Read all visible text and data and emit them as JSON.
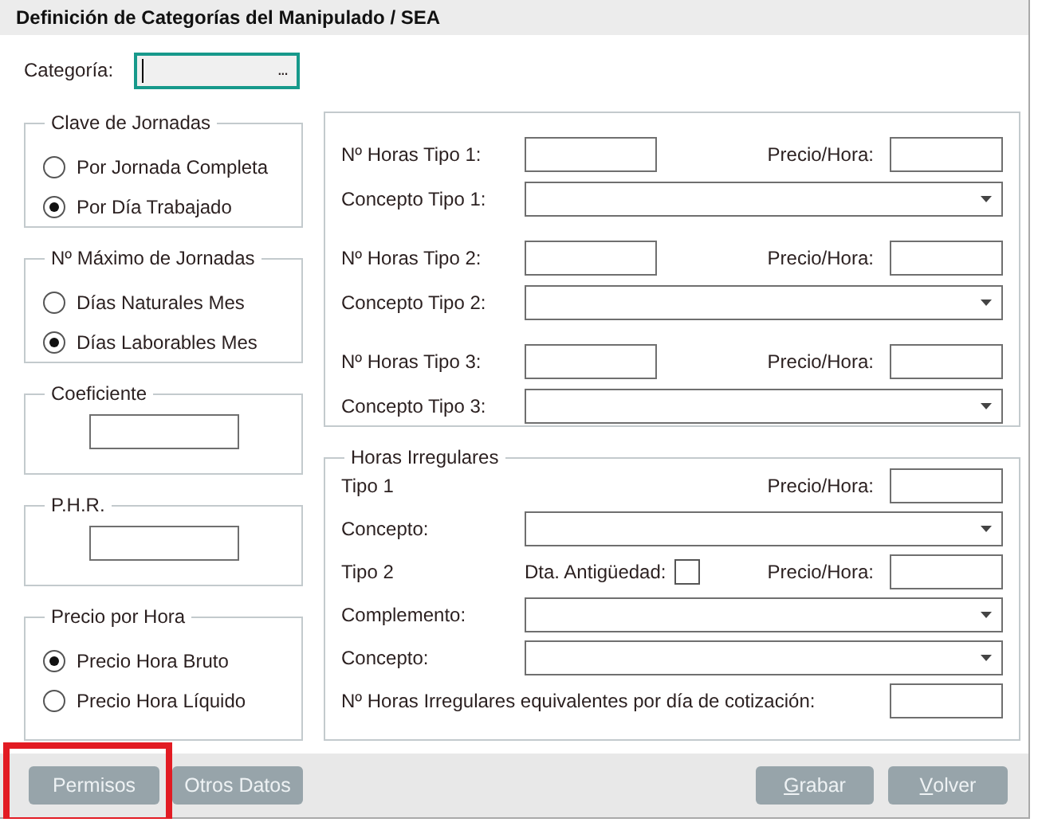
{
  "window": {
    "title": "Definición de Categorías del Manipulado / SEA"
  },
  "categoria": {
    "label": "Categoría:",
    "lookup_button": "...",
    "focused": true
  },
  "left_groups": [
    {
      "kind": "radio",
      "legend": "Clave de Jornadas",
      "options": [
        {
          "label": "Por Jornada Completa",
          "selected": false
        },
        {
          "label": "Por Día Trabajado",
          "selected": true
        }
      ]
    },
    {
      "kind": "radio",
      "legend": "Nº Máximo de Jornadas",
      "options": [
        {
          "label": "Días Naturales Mes",
          "selected": false
        },
        {
          "label": "Días Laborables Mes",
          "selected": true
        }
      ]
    },
    {
      "kind": "text",
      "legend": "Coeficiente"
    },
    {
      "kind": "text",
      "legend": "P.H.R."
    },
    {
      "kind": "radio",
      "legend": "Precio por Hora",
      "options": [
        {
          "label": "Precio Hora Bruto",
          "selected": true
        },
        {
          "label": "Precio Hora Líquido",
          "selected": false
        }
      ]
    }
  ],
  "tipos": [
    {
      "hours_label": "Nº Horas Tipo 1:",
      "price_label": "Precio/Hora:",
      "concept_label": "Concepto Tipo 1:"
    },
    {
      "hours_label": "Nº Horas Tipo 2:",
      "price_label": "Precio/Hora:",
      "concept_label": "Concepto Tipo 2:"
    },
    {
      "hours_label": "Nº Horas Tipo 3:",
      "price_label": "Precio/Hora:",
      "concept_label": "Concepto Tipo 3:"
    }
  ],
  "horas_irregulares": {
    "legend": "Horas Irregulares",
    "rows": [
      {
        "kind": "price",
        "label": "Tipo 1",
        "price_label": "Precio/Hora:"
      },
      {
        "kind": "combo",
        "label": "Concepto:"
      },
      {
        "kind": "price",
        "label": "Tipo 2",
        "check_label": "Dta. Antigüedad:",
        "checked": false,
        "price_label": "Precio/Hora:"
      },
      {
        "kind": "combo",
        "label": "Complemento:"
      },
      {
        "kind": "combo",
        "label": "Concepto:"
      },
      {
        "kind": "value",
        "label": "Nº Horas Irregulares equivalentes por día de cotización:"
      }
    ]
  },
  "buttons_left": [
    {
      "label": "Permisos",
      "highlighted": true
    },
    {
      "label": "Otros Datos",
      "highlighted": false
    }
  ],
  "buttons_right": [
    {
      "access_key": "G",
      "rest": "rabar"
    },
    {
      "access_key": "V",
      "rest": "olver"
    }
  ]
}
